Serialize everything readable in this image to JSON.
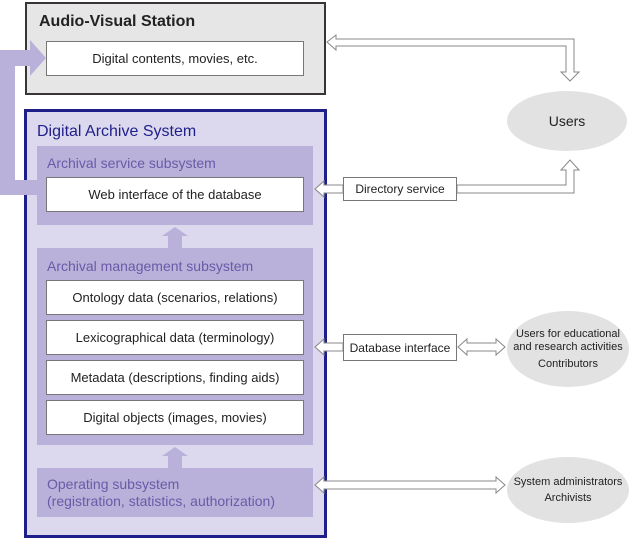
{
  "av_station": {
    "title": "Audio-Visual Station",
    "content": "Digital contents, movies, etc."
  },
  "das": {
    "title": "Digital Archive System",
    "service": {
      "title": "Archival service subsystem",
      "item": "Web interface of the database"
    },
    "management": {
      "title": "Archival management subsystem",
      "items": [
        "Ontology data (scenarios, relations)",
        "Lexicographical data (terminology)",
        "Metadata (descriptions, finding aids)",
        "Digital objects (images, movies)"
      ]
    },
    "operating": {
      "line1": "Operating subsystem",
      "line2": "(registration, statistics, authorization)"
    }
  },
  "interfaces": {
    "directory": "Directory service",
    "database": "Database interface"
  },
  "actors": {
    "users": "Users",
    "edu_line1": "Users for educational",
    "edu_line2": "and research activities",
    "contributors": "Contributors",
    "admins": "System administrators",
    "archivists": "Archivists"
  },
  "colors": {
    "das_border": "#1f1f8a",
    "subsystem": "#b9b1d9",
    "das_bg": "#dcd9ee",
    "title_sub": "#6a5aa8"
  }
}
